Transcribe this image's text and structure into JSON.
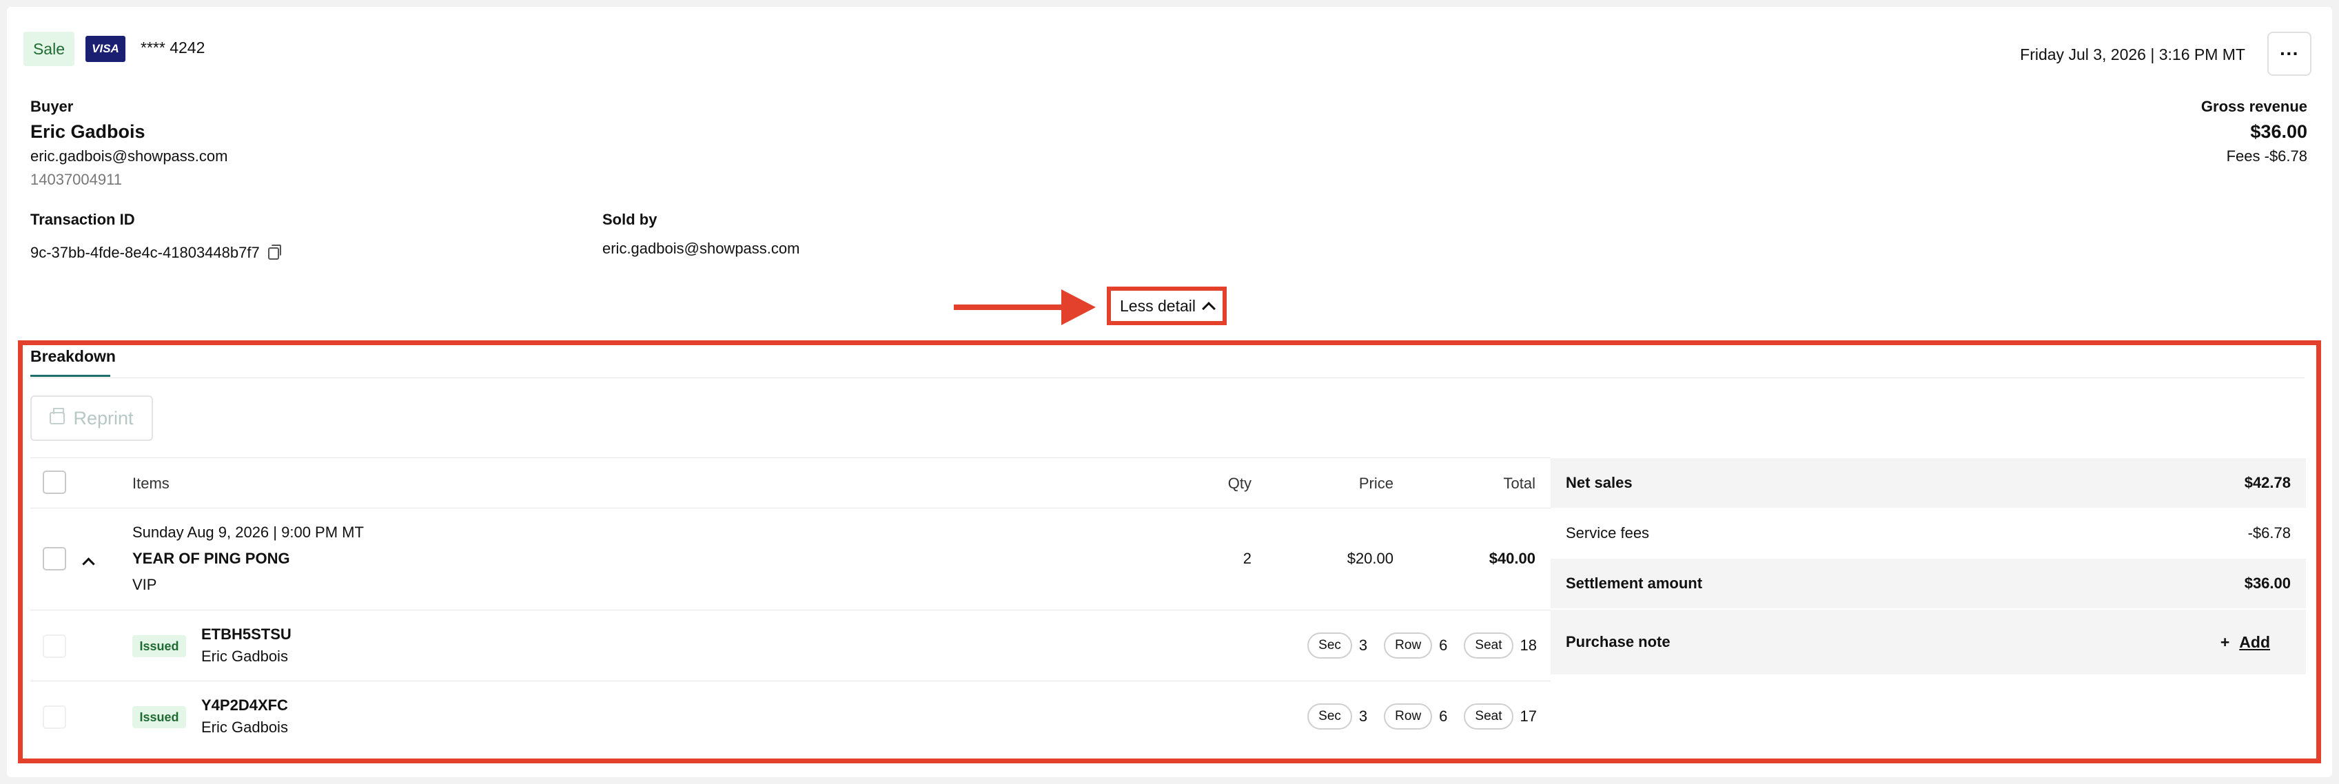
{
  "header": {
    "type_badge": "Sale",
    "card_brand": "VISA",
    "card_last4": "**** 4242",
    "datetime": "Friday Jul 3, 2026 | 3:16 PM MT",
    "more_label": "···"
  },
  "buyer": {
    "label": "Buyer",
    "name": "Eric Gadbois",
    "email": "eric.gadbois@showpass.com",
    "phone": "14037004911"
  },
  "revenue": {
    "label": "Gross revenue",
    "amount": "$36.00",
    "fees": "Fees -$6.78"
  },
  "transaction": {
    "label": "Transaction ID",
    "id": "9c-37bb-4fde-8e4c-41803448b7f7"
  },
  "sold_by": {
    "label": "Sold by",
    "value": "eric.gadbois@showpass.com"
  },
  "toggle": {
    "label": "Less detail"
  },
  "tabs": [
    {
      "label": "Breakdown"
    }
  ],
  "reprint": {
    "label": "Reprint"
  },
  "table": {
    "headers": {
      "items": "Items",
      "qty": "Qty",
      "price": "Price",
      "total": "Total"
    },
    "item": {
      "date": "Sunday Aug 9, 2026 | 9:00 PM MT",
      "name": "YEAR OF PING PONG",
      "tier": "VIP",
      "qty": "2",
      "price": "$20.00",
      "total": "$40.00"
    },
    "tickets": [
      {
        "status": "Issued",
        "code": "ETBH5STSU",
        "holder": "Eric Gadbois",
        "sec_label": "Sec",
        "sec": "3",
        "row_label": "Row",
        "row": "6",
        "seat_label": "Seat",
        "seat": "18"
      },
      {
        "status": "Issued",
        "code": "Y4P2D4XFC",
        "holder": "Eric Gadbois",
        "sec_label": "Sec",
        "sec": "3",
        "row_label": "Row",
        "row": "6",
        "seat_label": "Seat",
        "seat": "17"
      }
    ]
  },
  "summary": {
    "net_sales_label": "Net sales",
    "net_sales": "$42.78",
    "service_fees_label": "Service fees",
    "service_fees": "-$6.78",
    "settlement_label": "Settlement amount",
    "settlement": "$36.00",
    "purchase_note_label": "Purchase note",
    "add_label": "Add",
    "add_icon": "+"
  },
  "colors": {
    "annotation_red": "#e3412b",
    "success_bg": "#e3f6e7",
    "success_text": "#1f6b33",
    "visa_blue": "#1a1f71",
    "tab_accent": "#1e6f6b"
  }
}
